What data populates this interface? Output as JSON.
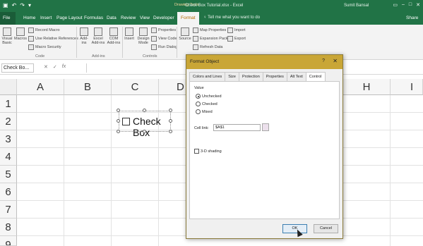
{
  "window": {
    "doc_title": "Check Box Tutorial.xlsx  -  Excel",
    "contextual_group": "Drawing Tools",
    "user": "Sumit Bansal"
  },
  "tabs": [
    "File",
    "Home",
    "Insert",
    "Page Layout",
    "Formulas",
    "Data",
    "Review",
    "View",
    "Developer",
    "Format"
  ],
  "tell_me": "Tell me what you want to do",
  "share": "Share",
  "ribbon": {
    "visual_basic": "Visual Basic",
    "macros": "Macros",
    "record_macro": "Record Macro",
    "relative_refs": "Use Relative References",
    "macro_security": "Macro Security",
    "code_label": "Code",
    "addins": "Add-ins",
    "excel_addins": "Excel Add-ins",
    "com_addins": "COM Add-ins",
    "addins_label": "Add-ins",
    "insert": "Insert",
    "design_mode": "Design Mode",
    "properties": "Properties",
    "view_code": "View Code",
    "run_dialog": "Run Dialog",
    "controls_label": "Controls",
    "source": "Source",
    "map_properties": "Map Properties",
    "expansion_packs": "Expansion Packs",
    "refresh_data": "Refresh Data",
    "import": "Import",
    "export": "Export"
  },
  "formula_bar": {
    "name_box": "Check Bo...",
    "cancel_icon": "✕",
    "enter_icon": "✓",
    "fx": "fx"
  },
  "grid": {
    "columns": [
      "A",
      "B",
      "C",
      "D",
      "H",
      "I"
    ],
    "rows": [
      "1",
      "2",
      "3",
      "4",
      "5",
      "6",
      "7",
      "8",
      "9"
    ]
  },
  "checkbox_control": {
    "label": "Check Box",
    "checked": false
  },
  "dialog": {
    "title": "Format Object",
    "help": "?",
    "close": "✕",
    "tabs": [
      "Colors and Lines",
      "Size",
      "Protection",
      "Properties",
      "Alt Text",
      "Control"
    ],
    "active_tab": "Control",
    "value_heading": "Value",
    "options": [
      "Unchecked",
      "Checked",
      "Mixed"
    ],
    "selected_option": "Unchecked",
    "cell_link_label": "Cell link:",
    "cell_link_value": "$A$1",
    "shading_label": "3-D shading",
    "ok_label": "OK",
    "cancel_label": "Cancel"
  }
}
